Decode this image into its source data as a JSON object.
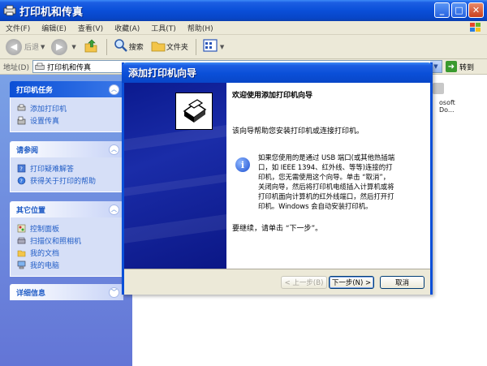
{
  "window": {
    "title": "打印机和传真"
  },
  "menu": [
    "文件(F)",
    "编辑(E)",
    "查看(V)",
    "收藏(A)",
    "工具(T)",
    "帮助(H)"
  ],
  "toolbar": {
    "back": "后退",
    "search": "搜索",
    "folders": "文件夹"
  },
  "address": {
    "label": "地址(D)",
    "value": "打印机和传真",
    "go": "转到"
  },
  "taskpane": {
    "printer_tasks": {
      "title": "打印机任务",
      "items": [
        "添加打印机",
        "设置传真"
      ]
    },
    "see_also": {
      "title": "请参阅",
      "items": [
        "打印疑难解答",
        "获得关于打印的帮助"
      ]
    },
    "other_places": {
      "title": "其它位置",
      "items": [
        "控制面板",
        "扫描仪和照相机",
        "我的文档",
        "我的电脑"
      ]
    },
    "details": {
      "title": "详细信息"
    }
  },
  "background": {
    "item_text": "osoft\nDo..."
  },
  "wizard": {
    "title": "添加打印机向导",
    "heading": "欢迎使用添加打印机向导",
    "intro": "该向导帮助您安装打印机或连接打印机。",
    "info_lines": [
      "如果您使用的是通过 USB 端口(或其他热插端",
      "口，如 IEEE 1394、红外线、等等)连接的打",
      "印机，您无需使用这个向导。单击 “取消”，",
      "关闭向导，然后将打印机电缆插入计算机或将",
      "打印机面向计算机的红外线端口，然后打开打",
      "印机。Windows 会自动安装打印机。"
    ],
    "continue": "要继续，请单击 “下一步”。",
    "buttons": {
      "back": "< 上一步(B)",
      "next": "下一步(N) >",
      "cancel": "取消"
    }
  },
  "colors": {
    "xp_blue": "#0a4fd8",
    "taskpane": "#6375d6",
    "link": "#215dc6"
  }
}
